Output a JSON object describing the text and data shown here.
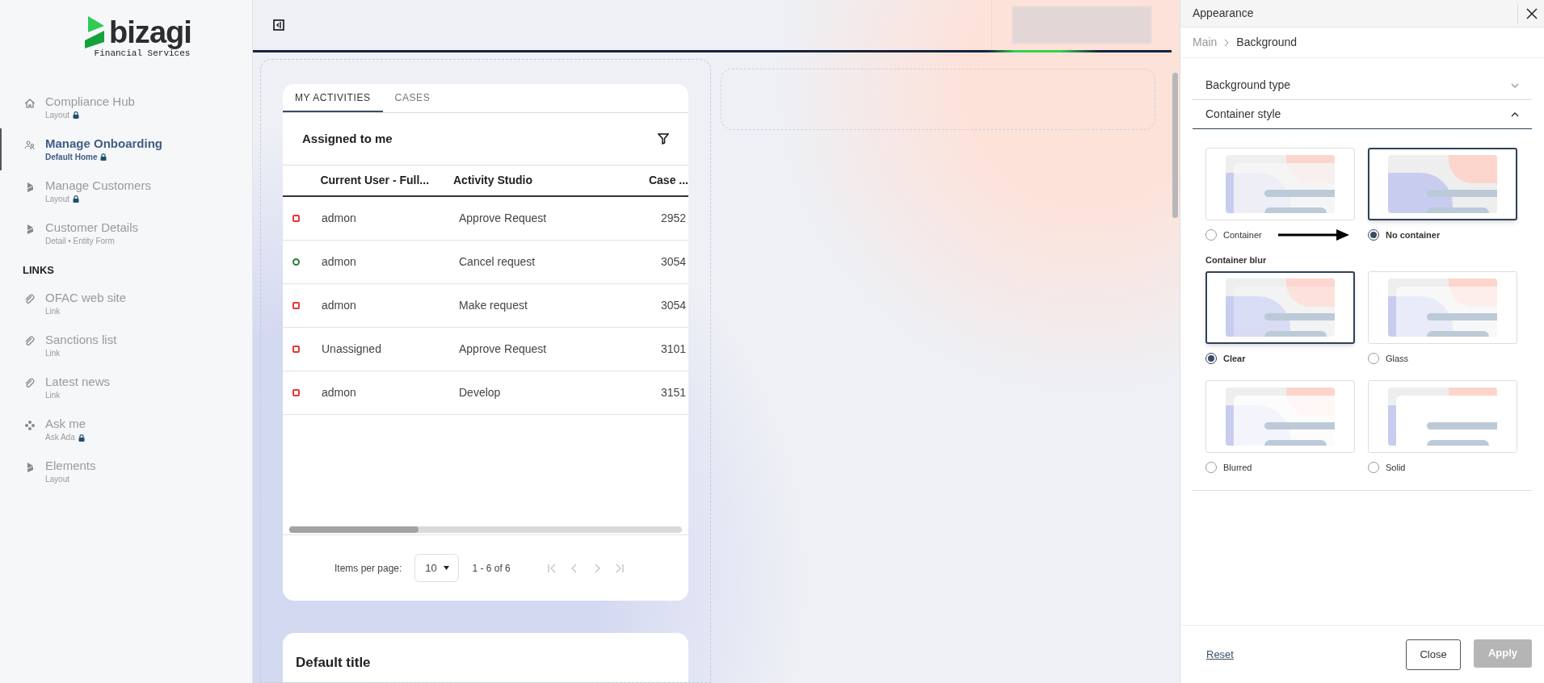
{
  "sidebar": {
    "logo": {
      "name": "bizagi",
      "subtitle": "Financial Services"
    },
    "items": [
      {
        "label": "Compliance Hub",
        "sublabel": "Layout",
        "locked": true,
        "selected": false
      },
      {
        "label": "Manage Onboarding",
        "sublabel": "Default Home",
        "locked": true,
        "selected": true
      },
      {
        "label": "Manage Customers",
        "sublabel": "Layout",
        "locked": true,
        "selected": false
      },
      {
        "label": "Customer Details",
        "sublabel": "Detail • Entity Form",
        "locked": false,
        "selected": false
      }
    ],
    "links_heading": "LINKS",
    "links": [
      {
        "label": "OFAC web site",
        "sublabel": "Link",
        "locked": false,
        "selected": false
      },
      {
        "label": "Sanctions list",
        "sublabel": "Link",
        "locked": false,
        "selected": false
      },
      {
        "label": "Latest news",
        "sublabel": "Link",
        "locked": false,
        "selected": false
      },
      {
        "label": "Ask me",
        "sublabel": "Ask Ada",
        "locked": true,
        "selected": false
      },
      {
        "label": "Elements",
        "sublabel": "Layout",
        "locked": false,
        "selected": false
      }
    ]
  },
  "activities": {
    "tabs": [
      {
        "label": "MY ACTIVITIES",
        "selected": true
      },
      {
        "label": "CASES",
        "selected": false
      }
    ],
    "title": "Assigned to me",
    "columns": [
      "Current User - Full...",
      "Activity Studio",
      "Case ..."
    ],
    "rows": [
      {
        "kind": "square",
        "color": "#e53935",
        "cells": [
          "admon",
          "Approve Request",
          "2952"
        ]
      },
      {
        "kind": "circle",
        "color": "#2e7d32",
        "cells": [
          "admon",
          "Cancel request",
          "3054"
        ]
      },
      {
        "kind": "square",
        "color": "#e53935",
        "cells": [
          "admon",
          "Make request",
          "3054"
        ]
      },
      {
        "kind": "square",
        "color": "#e53935",
        "cells": [
          "Unassigned",
          "Approve Request",
          "3101"
        ]
      },
      {
        "kind": "square",
        "color": "#e53935",
        "cells": [
          "admon",
          "Develop",
          "3151"
        ]
      }
    ],
    "scroll": {
      "level": 0.33
    },
    "pagination": {
      "label": "Items per page:",
      "page_size": "10",
      "range": "1 - 6 of 6"
    }
  },
  "default_card": {
    "title": "Default title"
  },
  "panel": {
    "title": "Appearance",
    "breadcrumb": [
      "Main",
      "Background"
    ],
    "sections": [
      {
        "label": "Background type",
        "expanded": false
      },
      {
        "label": "Container style",
        "expanded": true
      }
    ],
    "container_options": [
      {
        "label": "Container",
        "kind": "container",
        "selected": false
      },
      {
        "label": "No container",
        "kind": "none",
        "selected": true
      }
    ],
    "blur_heading": "Container blur",
    "blur_options": [
      {
        "label": "Clear",
        "kind": "clear",
        "selected": true
      },
      {
        "label": "Glass",
        "kind": "glass",
        "selected": false
      },
      {
        "label": "Blurred",
        "kind": "blurred",
        "selected": false
      },
      {
        "label": "Solid",
        "kind": "solid",
        "selected": false
      }
    ],
    "reset": "Reset",
    "close": "Close",
    "apply": {
      "label": "Apply",
      "disabled": true
    }
  }
}
